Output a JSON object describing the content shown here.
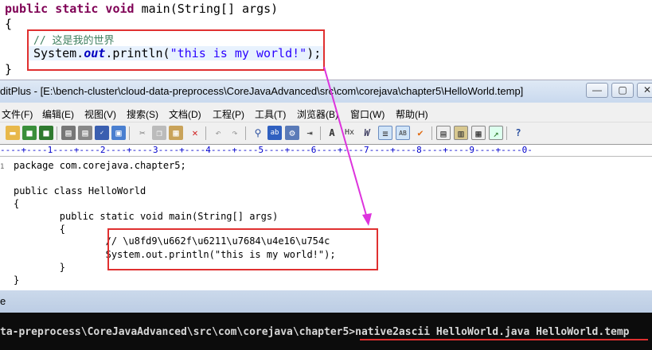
{
  "eclipse": {
    "line1": {
      "kw": "public static void",
      "rest": " main(String[] args)"
    },
    "line2": "{",
    "line3": "// 这是我的世界",
    "line4": {
      "pre": "System.",
      "field": "out",
      "mid": ".println(",
      "str": "\"this is my world!\"",
      "post": ");"
    },
    "line5": "}"
  },
  "editplus": {
    "title": "ditPlus - [E:\\bench-cluster\\cloud-data-preprocess\\CoreJavaAdvanced\\src\\com\\corejava\\chapter5\\HelloWorld.temp]",
    "window_buttons": [
      "—",
      "▢",
      "✕"
    ],
    "menu": [
      "文件(F)",
      "编辑(E)",
      "视图(V)",
      "搜索(S)",
      "文档(D)",
      "工程(P)",
      "工具(T)",
      "浏览器(B)",
      "窗口(W)",
      "帮助(H)"
    ],
    "ruler": "----+----1----+----2----+----3----+----4----+----5----+----6----+----7----+----8----+----9----+----0-",
    "code_lines": [
      "package com.corejava.chapter5;",
      "",
      "public class HelloWorld",
      "{",
      "        public static void main(String[] args)",
      "        {",
      "                // \\u8fd9\\u662f\\u6211\\u7684\\u4e16\\u754c",
      "                System.out.println(\"this is my world!\");",
      "        }",
      "}"
    ]
  },
  "status": {
    "text": "e"
  },
  "cmd": {
    "prefix": "ta-preprocess\\CoreJavaAdvanced\\src\\com\\corejava\\chapter5>",
    "command": "native2ascii HelloWorld.java HelloWorld.temp"
  },
  "colors": {
    "highlight_box": "#e03030",
    "arrow": "#dd33dd"
  }
}
